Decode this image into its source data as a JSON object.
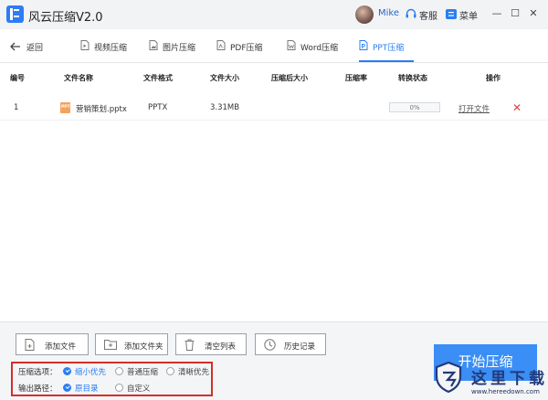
{
  "titlebar": {
    "app_title": "风云压缩V2.0",
    "user_name": "Mike",
    "service_label": "客服",
    "menu_label": "菜单",
    "minimize": "—",
    "maximize": "☐",
    "close": "✕"
  },
  "nav": {
    "back_label": "返回",
    "tabs": [
      {
        "label": "视频压缩",
        "icon": "video-file-icon"
      },
      {
        "label": "图片压缩",
        "icon": "image-file-icon"
      },
      {
        "label": "PDF压缩",
        "icon": "pdf-file-icon"
      },
      {
        "label": "Word压缩",
        "icon": "word-file-icon"
      },
      {
        "label": "PPT压缩",
        "icon": "ppt-file-icon",
        "active": true
      }
    ]
  },
  "table": {
    "headers": [
      "编号",
      "文件名称",
      "文件格式",
      "文件大小",
      "压缩后大小",
      "压缩率",
      "转换状态",
      "操作"
    ],
    "rows": [
      {
        "index": "1",
        "icon_text": "PPT",
        "name": "营销策划.pptx",
        "format": "PPTX",
        "size": "3.31MB",
        "compressed_size": "",
        "ratio": "",
        "progress": "0%",
        "progress_value": 0,
        "open_label": "打开文件",
        "delete_icon": "✕"
      }
    ]
  },
  "actions": {
    "add_file": "添加文件",
    "add_folder": "添加文件夹",
    "clear_list": "清空列表",
    "history": "历史记录",
    "start": "开始压缩"
  },
  "options": {
    "compress_label": "压缩选项：",
    "compress_choices": [
      {
        "label": "缩小优先",
        "checked": true
      },
      {
        "label": "普通压缩",
        "checked": false
      },
      {
        "label": "清晰优先",
        "checked": false
      }
    ],
    "output_label": "输出路径：",
    "output_choices": [
      {
        "label": "原目录",
        "checked": true
      },
      {
        "label": "自定义",
        "checked": false
      }
    ]
  },
  "watermark": {
    "text": "这里下载",
    "url": "www.hereedown.com"
  },
  "colors": {
    "accent": "#2a7ef2",
    "danger": "#e0433d",
    "highlight_box": "#d2302a"
  }
}
